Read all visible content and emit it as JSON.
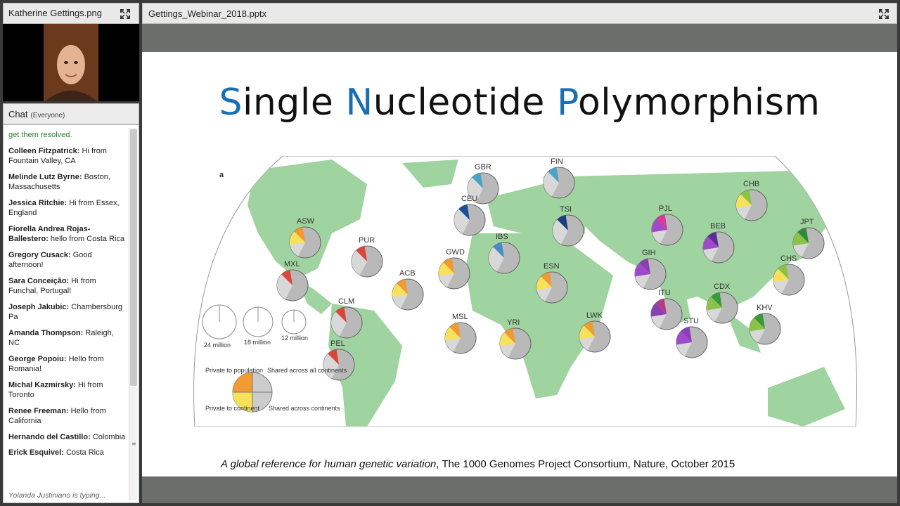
{
  "presenter_pod": {
    "title": "Katherine Gettings.png"
  },
  "chat": {
    "title": "Chat",
    "scope": "(Everyone)",
    "partial_top": "get them resolved.",
    "messages": [
      {
        "name": "Colleen Fitzpatrick:",
        "text": "Hi from Fountain Valley, CA"
      },
      {
        "name": "Melinde Lutz Byrne:",
        "text": "Boston, Massachusetts"
      },
      {
        "name": "Jessica Ritchie:",
        "text": "Hi from Essex, England"
      },
      {
        "name": "Fiorella Andrea Rojas-Ballestero:",
        "text": "hello from Costa Rica"
      },
      {
        "name": "Gregory   Cusack:",
        "text": "Good afternoon!"
      },
      {
        "name": "Sara Conceição:",
        "text": "Hi from Funchal, Portugal!"
      },
      {
        "name": "Joseph Jakubic:",
        "text": "Chambersburg Pa"
      },
      {
        "name": "Amanda Thompson:",
        "text": "Raleigh, NC"
      },
      {
        "name": "George Popoiu:",
        "text": "Hello from Romania!"
      },
      {
        "name": "Michal Kazmirsky:",
        "text": "Hi from Toronto"
      },
      {
        "name": "Renee Freeman:",
        "text": "Hello from California"
      },
      {
        "name": "Hernando del Castillo:",
        "text": "Colombia"
      },
      {
        "name": "Erick Esquivel:",
        "text": "Costa Rica"
      }
    ],
    "typing": "Yolanda Justiniano is typing..."
  },
  "share_pod": {
    "title": "Gettings_Webinar_2018.pptx"
  },
  "slide": {
    "title_parts": [
      "S",
      "ingle ",
      "N",
      "ucleotide ",
      "P",
      "olymorphism"
    ],
    "accent_color": "#1a6fb4",
    "caption_italic": "A global reference for human genetic variation",
    "caption_rest": ", The 1000 Genomes Project Consortium, Nature, October 2015",
    "figure": {
      "panel_label": "a",
      "scale": [
        "24 million",
        "18 million",
        "12 million"
      ],
      "legend": {
        "private_population": "Private to population",
        "shared_all": "Shared across all continents",
        "private_continent": "Private to continent",
        "shared_continents": "Shared across continents"
      },
      "populations": [
        "ASW",
        "PUR",
        "ACB",
        "MXL",
        "CLM",
        "PEL",
        "GBR",
        "CEU",
        "FIN",
        "IBS",
        "TSI",
        "GWD",
        "ESN",
        "MSL",
        "YRI",
        "LWK",
        "PJL",
        "GIH",
        "ITU",
        "STU",
        "BEB",
        "CHB",
        "JPT",
        "CHS",
        "CDX",
        "KHV"
      ]
    }
  }
}
